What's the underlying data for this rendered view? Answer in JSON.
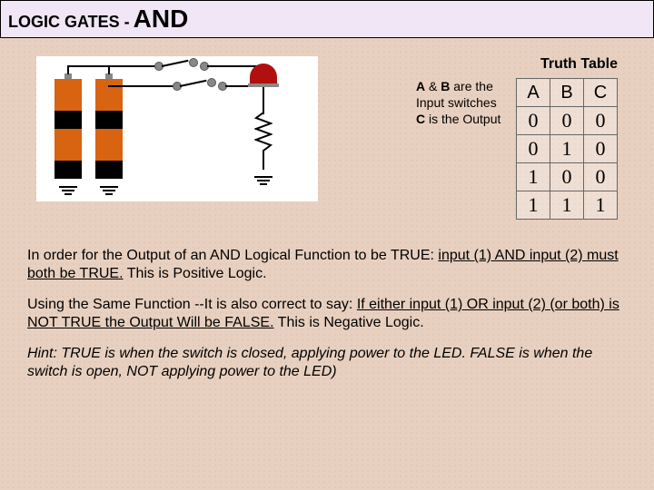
{
  "header": {
    "prefix": "LOGIC GATES - ",
    "gate": "AND"
  },
  "truth": {
    "title": "Truth Table",
    "desc_html": "<b>A</b> & <b>B</b> are the Input switches <b>C</b> is the Output",
    "headers": [
      "A",
      "B",
      "C"
    ],
    "rows": [
      [
        "0",
        "0",
        "0"
      ],
      [
        "0",
        "1",
        "0"
      ],
      [
        "1",
        "0",
        "0"
      ],
      [
        "1",
        "1",
        "1"
      ]
    ]
  },
  "paras": {
    "p1": "In order for the Output of an AND Logical Function to be TRUE: <span class='u'>input (1) AND input (2) must both be TRUE.</span> This is Positive Logic.",
    "p2": "Using the Same Function --It is also correct to say: <span class='u'>If either input (1) OR input (2) (or both) is NOT TRUE the Output Will be FALSE.</span> This is Negative Logic.",
    "p3": "Hint: TRUE is when the switch is closed,  applying power to the LED.  FALSE is when the switch is open,  NOT applying power to the LED)"
  }
}
